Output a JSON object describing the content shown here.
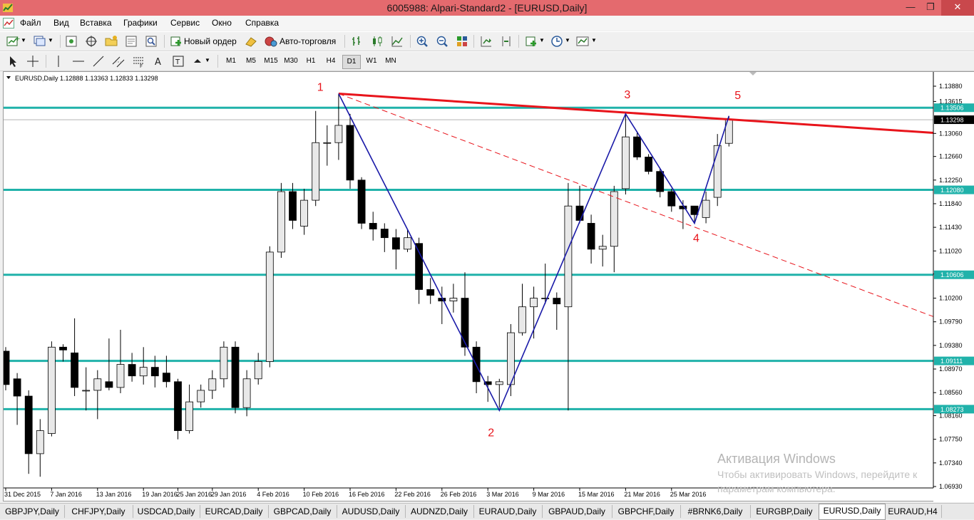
{
  "window": {
    "title": "6005988: Alpari-Standard2 - [EURUSD,Daily]"
  },
  "menu": [
    "Файл",
    "Вид",
    "Вставка",
    "Графики",
    "Сервис",
    "Окно",
    "Справка"
  ],
  "toolbar": {
    "new_order_label": "Новый ордер",
    "auto_trading_label": "Авто-торговля"
  },
  "timeframes": [
    "M1",
    "M5",
    "M15",
    "M30",
    "H1",
    "H4",
    "D1",
    "W1",
    "MN"
  ],
  "active_timeframe": "D1",
  "chart": {
    "header": "EURUSD,Daily  1.12888 1.13363 1.12833 1.13298",
    "price_labels": [
      "1.13880",
      "1.13615",
      "1.13060",
      "1.12660",
      "1.12250",
      "1.11840",
      "1.11430",
      "1.11020",
      "1.10620",
      "1.10200",
      "1.09790",
      "1.09380",
      "1.08970",
      "1.08560",
      "1.08160",
      "1.07750",
      "1.07340",
      "1.06930"
    ],
    "level_labels": [
      "1.13506",
      "1.12080",
      "1.10606",
      "1.09111",
      "1.08273"
    ],
    "current_price": "1.13298",
    "date_labels": [
      "31 Dec 2015",
      "7 Jan 2016",
      "13 Jan 2016",
      "19 Jan 2016",
      "25 Jan 2016",
      "29 Jan 2016",
      "4 Feb 2016",
      "10 Feb 2016",
      "16 Feb 2016",
      "22 Feb 2016",
      "26 Feb 2016",
      "3 Mar 2016",
      "9 Mar 2016",
      "15 Mar 2016",
      "21 Mar 2016",
      "25 Mar 2016"
    ],
    "wave_labels": [
      "1",
      "2",
      "3",
      "4",
      "5"
    ]
  },
  "colors": {
    "level": "#20b2aa",
    "trend": "#e8141b",
    "wave": "#1a1aa8",
    "title_bar": "#e46a6e"
  },
  "tabs": [
    "GBPJPY,Daily",
    "CHFJPY,Daily",
    "USDCAD,Daily",
    "EURCAD,Daily",
    "GBPCAD,Daily",
    "AUDUSD,Daily",
    "AUDNZD,Daily",
    "EURAUD,Daily",
    "GBPAUD,Daily",
    "GBPCHF,Daily",
    "#BRNK6,Daily",
    "EURGBP,Daily",
    "EURUSD,Daily",
    "EURAUD,H4"
  ],
  "active_tab": "EURUSD,Daily",
  "watermark": {
    "line1": "Активация Windows",
    "line2": "Чтобы активировать Windows, перейдите к",
    "line3": "параметрам компьютера."
  },
  "chart_data": {
    "type": "candlestick",
    "symbol": "EURUSD",
    "timeframe": "Daily",
    "ohlc_header": {
      "open": 1.12888,
      "high": 1.13363,
      "low": 1.12833,
      "close": 1.13298
    },
    "y_range": [
      1.0693,
      1.1388
    ],
    "horizontal_levels": [
      1.13506,
      1.1208,
      1.10606,
      1.09111,
      1.08273
    ],
    "candles": [
      {
        "d": "31 Dec 2015",
        "o": 1.0928,
        "h": 1.0935,
        "l": 1.086,
        "c": 1.087
      },
      {
        "d": "",
        "o": 1.088,
        "h": 1.089,
        "l": 1.08,
        "c": 1.085
      },
      {
        "d": "",
        "o": 1.085,
        "h": 1.086,
        "l": 1.0715,
        "c": 1.075
      },
      {
        "d": "",
        "o": 1.075,
        "h": 1.081,
        "l": 1.071,
        "c": 1.079
      },
      {
        "d": "7 Jan 2016",
        "o": 1.0785,
        "h": 1.0945,
        "l": 1.078,
        "c": 1.0935
      },
      {
        "d": "",
        "o": 1.0935,
        "h": 1.094,
        "l": 1.091,
        "c": 1.093
      },
      {
        "d": "",
        "o": 1.0925,
        "h": 1.0985,
        "l": 1.085,
        "c": 1.0865
      },
      {
        "d": "",
        "o": 1.086,
        "h": 1.09,
        "l": 1.0825,
        "c": 1.086
      },
      {
        "d": "13 Jan 2016",
        "o": 1.086,
        "h": 1.0895,
        "l": 1.081,
        "c": 1.088
      },
      {
        "d": "",
        "o": 1.0875,
        "h": 1.095,
        "l": 1.086,
        "c": 1.0865
      },
      {
        "d": "",
        "o": 1.0865,
        "h": 1.0965,
        "l": 1.0855,
        "c": 1.0905
      },
      {
        "d": "",
        "o": 1.0905,
        "h": 1.0925,
        "l": 1.0875,
        "c": 1.0885
      },
      {
        "d": "19 Jan 2016",
        "o": 1.0885,
        "h": 1.0935,
        "l": 1.087,
        "c": 1.09
      },
      {
        "d": "",
        "o": 1.09,
        "h": 1.092,
        "l": 1.0865,
        "c": 1.0885
      },
      {
        "d": "",
        "o": 1.089,
        "h": 1.092,
        "l": 1.0865,
        "c": 1.0875
      },
      {
        "d": "25 Jan 2016",
        "o": 1.0875,
        "h": 1.088,
        "l": 1.0775,
        "c": 1.079
      },
      {
        "d": "",
        "o": 1.079,
        "h": 1.087,
        "l": 1.0785,
        "c": 1.084
      },
      {
        "d": "",
        "o": 1.084,
        "h": 1.087,
        "l": 1.083,
        "c": 1.086
      },
      {
        "d": "29 Jan 2016",
        "o": 1.086,
        "h": 1.0895,
        "l": 1.0845,
        "c": 1.088
      },
      {
        "d": "",
        "o": 1.088,
        "h": 1.0945,
        "l": 1.0865,
        "c": 1.0935
      },
      {
        "d": "",
        "o": 1.0935,
        "h": 1.0945,
        "l": 1.082,
        "c": 1.083
      },
      {
        "d": "",
        "o": 1.083,
        "h": 1.0895,
        "l": 1.0815,
        "c": 1.088
      },
      {
        "d": "4 Feb 2016",
        "o": 1.088,
        "h": 1.0925,
        "l": 1.087,
        "c": 1.091
      },
      {
        "d": "",
        "o": 1.091,
        "h": 1.111,
        "l": 1.09,
        "c": 1.11
      },
      {
        "d": "",
        "o": 1.11,
        "h": 1.122,
        "l": 1.109,
        "c": 1.1205
      },
      {
        "d": "",
        "o": 1.1205,
        "h": 1.122,
        "l": 1.114,
        "c": 1.1155
      },
      {
        "d": "10 Feb 2016",
        "o": 1.1145,
        "h": 1.121,
        "l": 1.113,
        "c": 1.119
      },
      {
        "d": "",
        "o": 1.119,
        "h": 1.1345,
        "l": 1.118,
        "c": 1.129
      },
      {
        "d": "",
        "o": 1.129,
        "h": 1.132,
        "l": 1.125,
        "c": 1.129
      },
      {
        "d": "",
        "o": 1.129,
        "h": 1.1375,
        "l": 1.126,
        "c": 1.132
      },
      {
        "d": "16 Feb 2016",
        "o": 1.132,
        "h": 1.134,
        "l": 1.121,
        "c": 1.1225
      },
      {
        "d": "",
        "o": 1.1225,
        "h": 1.123,
        "l": 1.114,
        "c": 1.115
      },
      {
        "d": "",
        "o": 1.115,
        "h": 1.117,
        "l": 1.112,
        "c": 1.114
      },
      {
        "d": "",
        "o": 1.114,
        "h": 1.115,
        "l": 1.11,
        "c": 1.1125
      },
      {
        "d": "22 Feb 2016",
        "o": 1.1125,
        "h": 1.114,
        "l": 1.107,
        "c": 1.1105
      },
      {
        "d": "",
        "o": 1.1105,
        "h": 1.114,
        "l": 1.11,
        "c": 1.1125
      },
      {
        "d": "",
        "o": 1.1115,
        "h": 1.1125,
        "l": 1.101,
        "c": 1.1035
      },
      {
        "d": "",
        "o": 1.1035,
        "h": 1.1055,
        "l": 1.101,
        "c": 1.1025
      },
      {
        "d": "26 Feb 2016",
        "o": 1.102,
        "h": 1.104,
        "l": 1.0975,
        "c": 1.1015
      },
      {
        "d": "",
        "o": 1.1015,
        "h": 1.1045,
        "l": 1.0995,
        "c": 1.102
      },
      {
        "d": "",
        "o": 1.102,
        "h": 1.1065,
        "l": 1.092,
        "c": 1.0935
      },
      {
        "d": "",
        "o": 1.0935,
        "h": 1.0945,
        "l": 1.0855,
        "c": 1.0875
      },
      {
        "d": "3 Mar 2016",
        "o": 1.0875,
        "h": 1.0885,
        "l": 1.084,
        "c": 1.087
      },
      {
        "d": "",
        "o": 1.087,
        "h": 1.088,
        "l": 1.083,
        "c": 1.0875
      },
      {
        "d": "",
        "o": 1.087,
        "h": 1.0975,
        "l": 1.085,
        "c": 1.096
      },
      {
        "d": "",
        "o": 1.096,
        "h": 1.1045,
        "l": 1.0955,
        "c": 1.1005
      },
      {
        "d": "9 Mar 2016",
        "o": 1.1005,
        "h": 1.104,
        "l": 1.095,
        "c": 1.102
      },
      {
        "d": "",
        "o": 1.102,
        "h": 1.108,
        "l": 1.101,
        "c": 1.102
      },
      {
        "d": "",
        "o": 1.102,
        "h": 1.103,
        "l": 1.0965,
        "c": 1.101
      },
      {
        "d": "",
        "o": 1.1005,
        "h": 1.122,
        "l": 1.0825,
        "c": 1.118
      },
      {
        "d": "15 Mar 2016",
        "o": 1.118,
        "h": 1.1215,
        "l": 1.115,
        "c": 1.1155
      },
      {
        "d": "",
        "o": 1.115,
        "h": 1.1165,
        "l": 1.108,
        "c": 1.1105
      },
      {
        "d": "",
        "o": 1.1105,
        "h": 1.113,
        "l": 1.1075,
        "c": 1.111
      },
      {
        "d": "",
        "o": 1.111,
        "h": 1.1215,
        "l": 1.1065,
        "c": 1.1205
      },
      {
        "d": "21 Mar 2016",
        "o": 1.121,
        "h": 1.134,
        "l": 1.12,
        "c": 1.13
      },
      {
        "d": "",
        "o": 1.13,
        "h": 1.131,
        "l": 1.126,
        "c": 1.1265
      },
      {
        "d": "",
        "o": 1.1265,
        "h": 1.127,
        "l": 1.1235,
        "c": 1.124
      },
      {
        "d": "",
        "o": 1.124,
        "h": 1.1245,
        "l": 1.1195,
        "c": 1.1205
      },
      {
        "d": "25 Mar 2016",
        "o": 1.1205,
        "h": 1.121,
        "l": 1.117,
        "c": 1.118
      },
      {
        "d": "",
        "o": 1.118,
        "h": 1.119,
        "l": 1.114,
        "c": 1.1175
      },
      {
        "d": "",
        "o": 1.118,
        "h": 1.118,
        "l": 1.115,
        "c": 1.1165
      },
      {
        "d": "",
        "o": 1.116,
        "h": 1.1205,
        "l": 1.115,
        "c": 1.119
      },
      {
        "d": "",
        "o": 1.1195,
        "h": 1.1305,
        "l": 1.118,
        "c": 1.1285
      },
      {
        "d": "",
        "o": 1.12888,
        "h": 1.13363,
        "l": 1.12833,
        "c": 1.13298
      }
    ]
  }
}
